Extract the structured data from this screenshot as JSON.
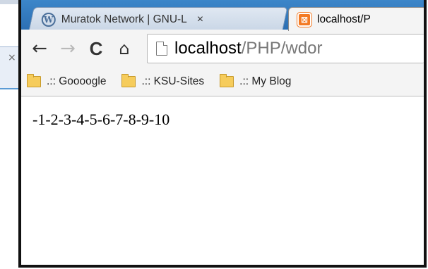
{
  "tabs": [
    {
      "label": "Muratok Network | GNU-L",
      "favicon": "wordpress-icon",
      "close": "×"
    },
    {
      "label": "localhost/P",
      "favicon": "xampp-icon"
    }
  ],
  "toolbar": {
    "back": "←",
    "forward": "→",
    "reload": "C",
    "home": "⌂"
  },
  "address_bar": {
    "host": "localhost",
    "path": "/PHP/wdor"
  },
  "bookmarks": [
    {
      "label": ".:: Goooogle"
    },
    {
      "label": ".:: KSU-Sites"
    },
    {
      "label": ".:: My Blog"
    }
  ],
  "page": {
    "output": "-1-2-3-4-5-6-7-8-9-10"
  },
  "background_window": {
    "glyph": "×"
  },
  "colors": {
    "tabstrip": "#2c6fb3",
    "window_border": "#111111",
    "xampp_orange": "#f37a24"
  }
}
